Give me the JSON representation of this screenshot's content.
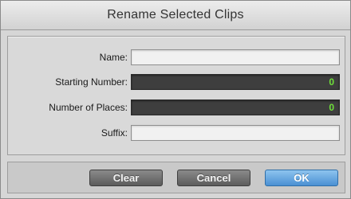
{
  "dialog": {
    "title": "Rename Selected Clips"
  },
  "form": {
    "name_label": "Name:",
    "name_value": "",
    "starting_number_label": "Starting Number:",
    "starting_number_value": "0",
    "number_of_places_label": "Number of Places:",
    "number_of_places_value": "0",
    "suffix_label": "Suffix:",
    "suffix_value": ""
  },
  "buttons": {
    "clear_label": "Clear",
    "cancel_label": "Cancel",
    "ok_label": "OK"
  },
  "colors": {
    "numeric_text": "#6fe03a",
    "primary_button": "#4a90d3"
  }
}
